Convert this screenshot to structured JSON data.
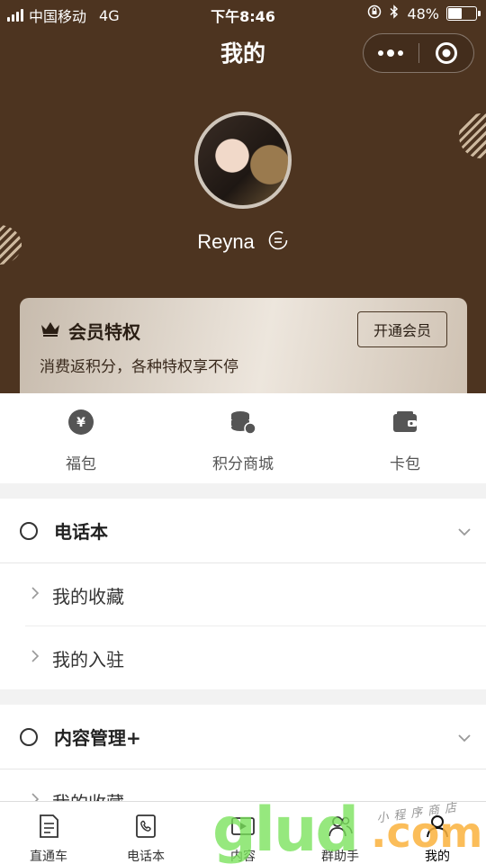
{
  "status_bar": {
    "carrier": "中国移动",
    "network": "4G",
    "time": "下午8:46",
    "battery": "48%",
    "battery_level": 0.48
  },
  "nav": {
    "title": "我的",
    "more_icon": "more-dots-icon",
    "close_icon": "target-close-icon"
  },
  "profile": {
    "name": "Reyna",
    "switch_icon": "switch-account-icon"
  },
  "vip": {
    "title": "会员特权",
    "subtitle": "消费返积分，各种特权享不停",
    "button": "开通会员",
    "icon": "crown-icon"
  },
  "quick_entries": [
    {
      "label": "福包",
      "icon": "yuan-coin-icon"
    },
    {
      "label": "积分商城",
      "icon": "coins-stack-icon"
    },
    {
      "label": "卡包",
      "icon": "wallet-icon"
    }
  ],
  "sections": [
    {
      "title": "电话本",
      "items": [
        "我的收藏",
        "我的入驻"
      ]
    },
    {
      "title": "内容管理+",
      "items": [
        "我的收藏"
      ]
    }
  ],
  "tabbar": [
    {
      "label": "直通车",
      "icon": "document-icon"
    },
    {
      "label": "电话本",
      "icon": "phone-book-icon"
    },
    {
      "label": "内容",
      "icon": "video-icon"
    },
    {
      "label": "群助手",
      "icon": "group-icon"
    },
    {
      "label": "我的",
      "icon": "user-icon",
      "active": true
    }
  ],
  "watermark": {
    "main": "glud",
    "suffix": ".com",
    "tagline": "小程序商店"
  },
  "colors": {
    "hero_bg": "#4d3420",
    "accent_line": "#cdb89e"
  }
}
